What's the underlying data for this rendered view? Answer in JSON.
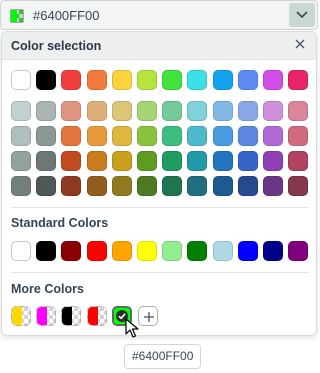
{
  "combo": {
    "value": "#6400FF00",
    "swatch_color": "#00ff00"
  },
  "panel": {
    "title": "Color selection",
    "close_icon": "close-icon",
    "palette_row0": [
      "#ffffff",
      "#000000",
      "#f03e3e",
      "#f5793b",
      "#fcd23f",
      "#b7e33d",
      "#40e33b",
      "#3ee0e8",
      "#15a3f0",
      "#5e8cf2",
      "#d34de6",
      "#e8246a"
    ],
    "palette_grid": [
      [
        "#c2d1cf",
        "#a9b4b3",
        "#de9680",
        "#e0ae78",
        "#ddc576",
        "#a5d474",
        "#73cb9a",
        "#7ed2d9",
        "#82b9e6",
        "#8ba8e6",
        "#d08fdc",
        "#d9869a"
      ],
      [
        "#b0bebd",
        "#8d9997",
        "#e2753e",
        "#e69a3e",
        "#deb83e",
        "#87c33d",
        "#3dbb80",
        "#4cbac8",
        "#4a9ddf",
        "#5c87e0",
        "#b16ad6",
        "#d26b80"
      ],
      [
        "#93a19f",
        "#6d7876",
        "#c24a20",
        "#c97c1e",
        "#c9a01f",
        "#5e9b23",
        "#1f9c62",
        "#239aa9",
        "#2375c2",
        "#3563c7",
        "#8e41b7",
        "#b0435f"
      ],
      [
        "#737f7d",
        "#4e5856",
        "#8f3a20",
        "#915d1c",
        "#917b20",
        "#4d7922",
        "#1f7550",
        "#1f6f7e",
        "#1d5a91",
        "#27498f",
        "#6c3687",
        "#843849"
      ]
    ],
    "standard_label": "Standard Colors",
    "standard_colors": [
      "#ffffff",
      "#000000",
      "#8b0000",
      "#ff0000",
      "#ffa500",
      "#ffff00",
      "#90ee90",
      "#008000",
      "#add8e6",
      "#0000ff",
      "#00008b",
      "#800080"
    ],
    "more_label": "More Colors",
    "more_colors": [
      "#ffd700",
      "#ff00ff",
      "#000000",
      "#ff0000",
      "#00ff00"
    ],
    "add_icon": "plus-icon"
  },
  "tooltip": {
    "text": "#6400FF00"
  }
}
